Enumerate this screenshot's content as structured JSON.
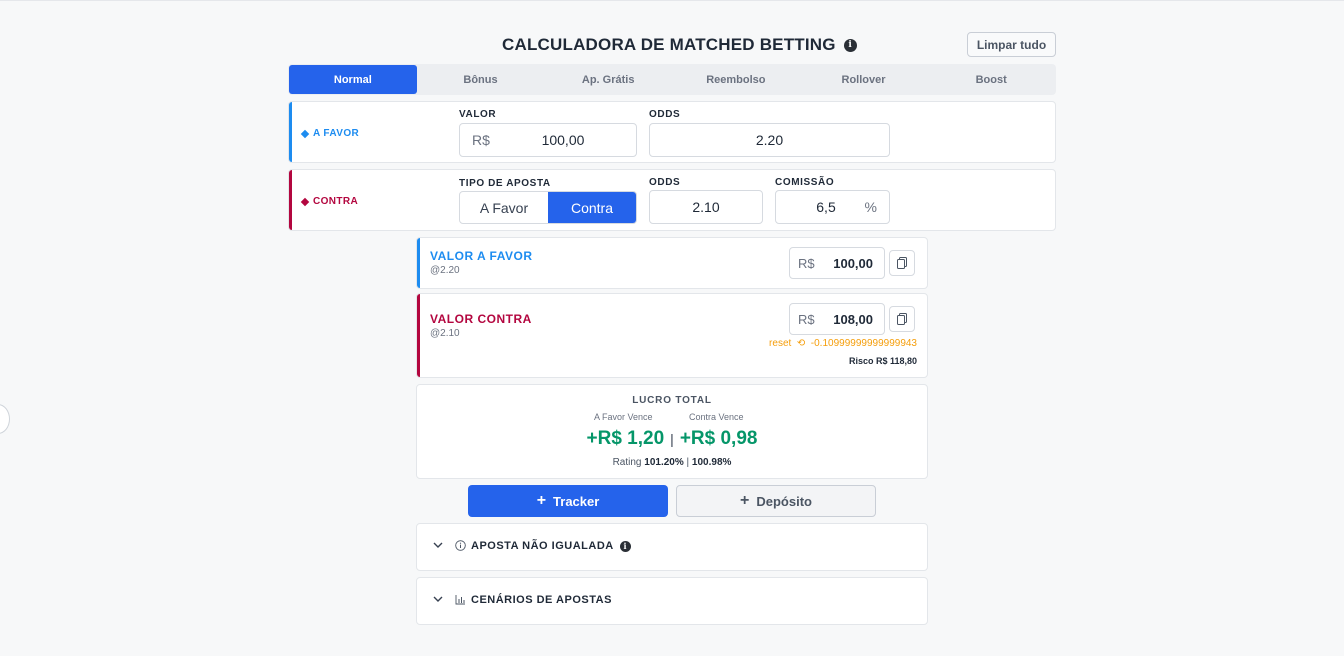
{
  "header": {
    "title": "CALCULADORA DE MATCHED BETTING",
    "clear_label": "Limpar tudo"
  },
  "tabs": [
    {
      "label": "Normal",
      "active": true
    },
    {
      "label": "Bônus"
    },
    {
      "label": "Ap. Grátis"
    },
    {
      "label": "Reembolso"
    },
    {
      "label": "Rollover"
    },
    {
      "label": "Boost"
    }
  ],
  "favor": {
    "label": "A FAVOR",
    "value_label": "VALOR",
    "currency": "R$",
    "value": "100,00",
    "odds_label": "ODDS",
    "odds": "2.20",
    "color": "#1d8cf0"
  },
  "contra": {
    "label": "CONTRA",
    "bet_type_label": "TIPO DE APOSTA",
    "bet_type_options": [
      "A Favor",
      "Contra"
    ],
    "bet_type_selected": "Contra",
    "odds_label": "ODDS",
    "odds": "2.10",
    "commission_label": "COMISSÃO",
    "commission": "6,5",
    "percent": "%",
    "color": "#b3063f"
  },
  "results": {
    "favor_title": "VALOR A FAVOR",
    "favor_odds": "@2.20",
    "favor_amount": "100,00",
    "contra_title": "VALOR CONTRA",
    "contra_odds": "@2.10",
    "contra_amount": "108,00",
    "currency": "R$",
    "reset_label": "reset",
    "reset_delta": "-0.10999999999999943",
    "risk": "Risco R$ 118,80"
  },
  "profit": {
    "title": "LUCRO TOTAL",
    "favor_wins_label": "A Favor Vence",
    "contra_wins_label": "Contra Vence",
    "favor_profit": "+R$ 1,20",
    "contra_profit": "+R$ 0,98",
    "separator": "|",
    "rating_label": "Rating",
    "rating_favor": "101.20%",
    "rating_contra": "100.98%",
    "color": "#059669"
  },
  "actions": {
    "tracker_label": "Tracker",
    "deposit_label": "Depósito"
  },
  "accordions": [
    {
      "label": "APOSTA NÃO IGUALADA",
      "icon": "info-circle-icon"
    },
    {
      "label": "CENÁRIOS DE APOSTAS",
      "icon": "bar-chart-icon"
    }
  ]
}
